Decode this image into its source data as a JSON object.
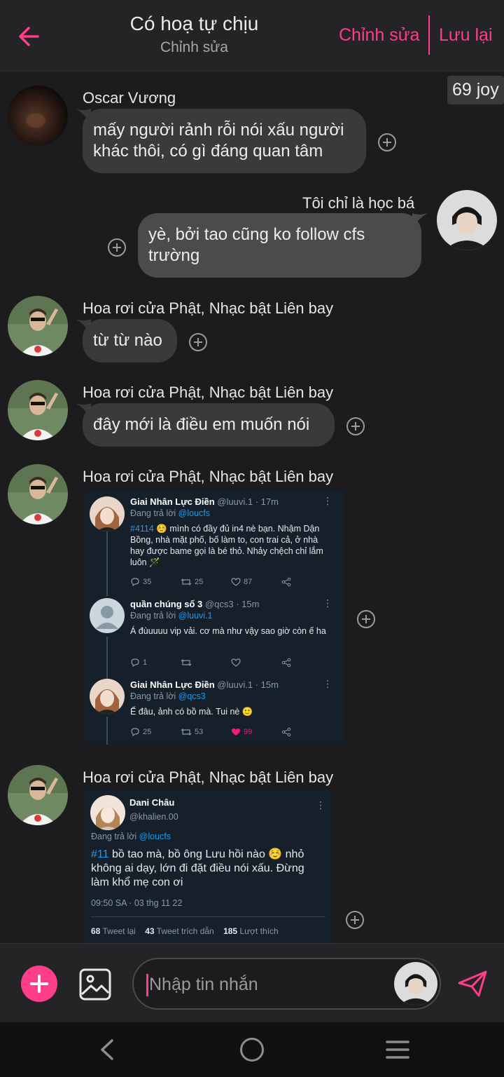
{
  "header": {
    "title": "Có hoạ tự chịu",
    "subtitle": "Chỉnh sửa",
    "edit_label": "Chỉnh sửa",
    "save_label": "Lưu lại",
    "accent": "#ff3d8b"
  },
  "chat": {
    "joy_label": "69 joy",
    "messages": [
      {
        "sender": "Oscar Vương",
        "text": "mấy người rảnh rỗi nói xấu người khác thôi, có gì đáng quan tâm"
      },
      {
        "sender": "Tôi chỉ là học bá",
        "text": "yè, bởi tao cũng ko follow cfs trường"
      },
      {
        "sender": "Hoa rơi cửa Phật, Nhạc bật Liên bay",
        "text": "từ từ nào"
      },
      {
        "sender": "Hoa rơi cửa Phật, Nhạc bật Liên bay",
        "text": "đây mới là điều em muốn nói"
      },
      {
        "sender": "Hoa rơi cửa Phật, Nhạc bật Liên bay"
      },
      {
        "sender": "Hoa rơi cửa Phật, Nhạc bật Liên bay"
      }
    ]
  },
  "tweet_thread": {
    "tweets": [
      {
        "name": "Giai Nhân Lực Điền",
        "handle": "@luuvi.1 · 17m",
        "reply_prefix": "Đang trả lời",
        "reply_to": "@loucfs",
        "hashtag": "#4114",
        "text": "☺️ mình có đầy đủ in4 nè bạn. Nhậm Dận Bồng, nhà mặt phố, bố làm to, con trai cả, ở nhà hay được bame gọi là bé thỏ. Nhảy chệch chỉ lắm luôn 🪄",
        "replies": "35",
        "retweets": "25",
        "likes": "87"
      },
      {
        "name": "quần chúng số 3",
        "handle": "@qcs3 · 15m",
        "reply_prefix": "Đang trả lời",
        "reply_to": "@luuvi.1",
        "text": "Á đùuuuu vip vải. cơ mà như vậy sao giờ còn ế ha",
        "replies": "1",
        "retweets": "",
        "likes": ""
      },
      {
        "name": "Giai Nhân Lực Điền",
        "handle": "@luuvi.1 · 15m",
        "reply_prefix": "Đang trả lời",
        "reply_to": "@qcs3",
        "text": "Ế đâu, ảnh có bồ mà. Tui nè 🙂",
        "replies": "25",
        "retweets": "53",
        "likes": "99"
      }
    ]
  },
  "tweet_single": {
    "name": "Dani Châu",
    "handle": "@khalien.00",
    "reply_prefix": "Đang trả lời",
    "reply_to": "@loucfs",
    "hashtag": "#11",
    "text": "bồ tao mà, bồ ông Lưu hồi nào ☺️ nhỏ không ai dạy, lớn đi đặt điều nói xấu. Đừng làm khổ mẹ con ơi",
    "time": "09:50 SA · 03 thg 11 22",
    "retweets": "68",
    "retweets_label": "Tweet lại",
    "quotes": "43",
    "quotes_label": "Tweet trích dẫn",
    "likes": "185",
    "likes_label": "Lượt thích"
  },
  "composer": {
    "placeholder": "Nhập tin nhắn"
  }
}
